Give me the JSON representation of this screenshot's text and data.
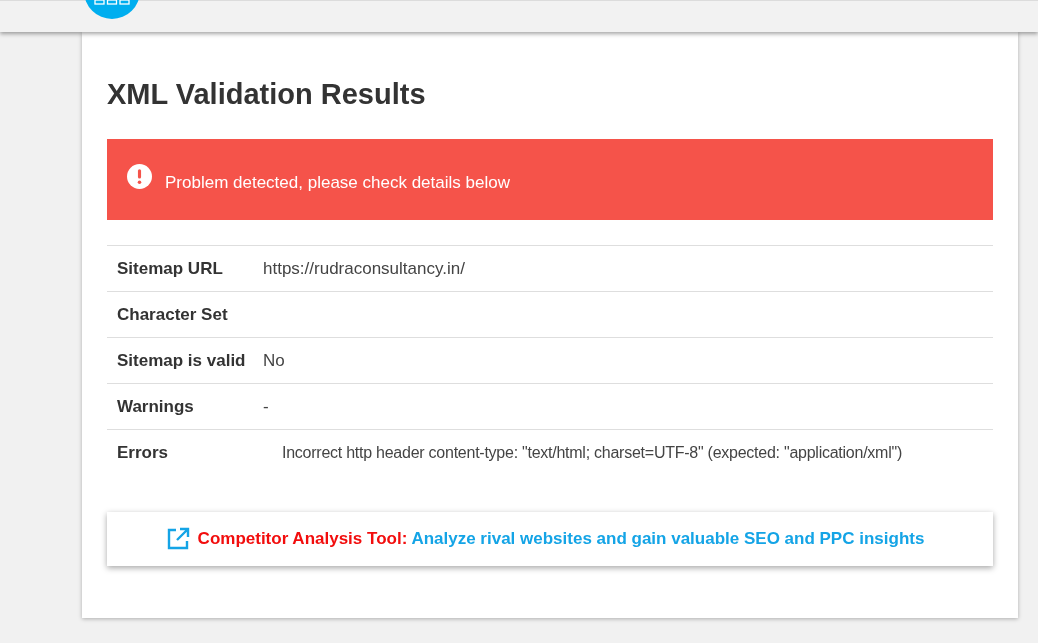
{
  "title": "XML Validation Results",
  "alert": {
    "kind": "error",
    "message": "Problem detected, please check details below"
  },
  "results": [
    {
      "kind": "text",
      "label": "Sitemap URL",
      "value": "https://rudraconsultancy.in/"
    },
    {
      "kind": "text",
      "label": "Character Set"
    },
    {
      "kind": "text",
      "label": "Sitemap is valid",
      "value": "No"
    },
    {
      "kind": "text",
      "label": "Warnings",
      "value": "-"
    },
    {
      "kind": "list",
      "label": "Errors",
      "items": [
        "Incorrect http header content-type: \"text/html; charset=UTF-8\" (expected: \"application/xml\")"
      ]
    }
  ],
  "promo": {
    "label": "Competitor Analysis Tool:",
    "link": "Analyze rival websites and gain valuable SEO and PPC insights"
  }
}
